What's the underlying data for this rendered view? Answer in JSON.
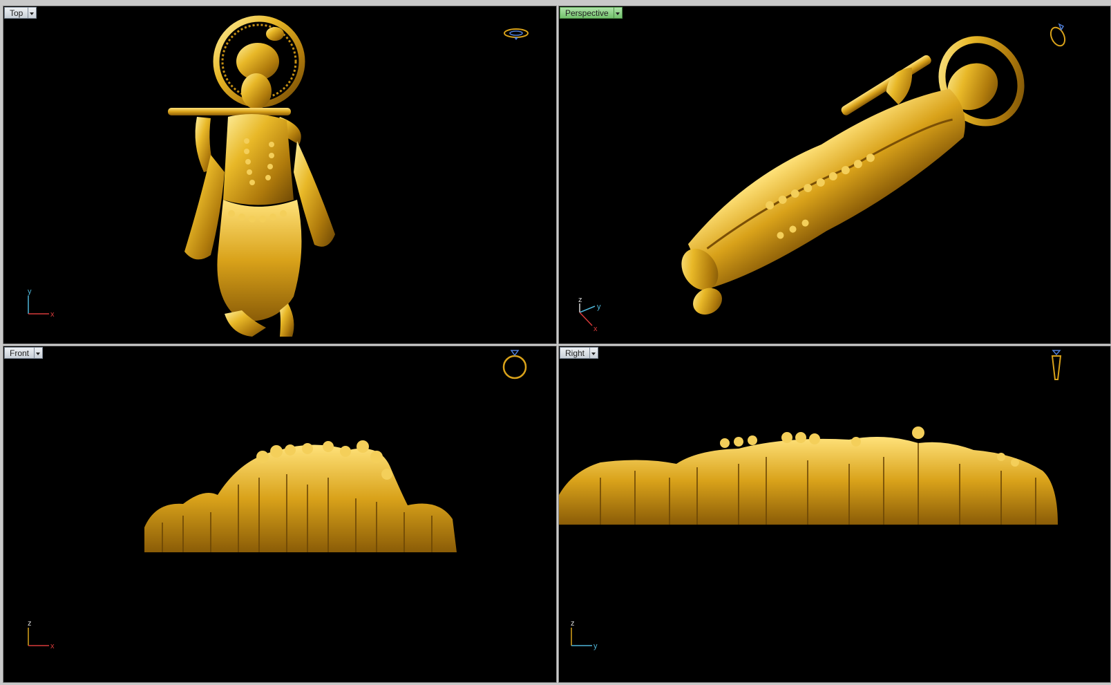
{
  "viewports": {
    "top": {
      "label": "Top",
      "axes": {
        "h": "x",
        "v": "y"
      }
    },
    "perspective": {
      "label": "Perspective",
      "axes": {
        "a": "z",
        "b": "y",
        "c": "x"
      }
    },
    "front": {
      "label": "Front",
      "axes": {
        "h": "x",
        "v": "z"
      }
    },
    "right": {
      "label": "Right",
      "axes": {
        "h": "y",
        "v": "z"
      }
    }
  },
  "colors": {
    "background": "#000000",
    "gold": "#d8a21a",
    "axis_x": "#d83a3a",
    "axis_y": "#4fb6d8",
    "axis_z": "#d8d8d8",
    "active_tab": "#72c06c"
  },
  "icons": {
    "top": "ring-top-icon",
    "perspective": "ring-perspective-icon",
    "front": "ring-front-icon",
    "right": "ring-side-icon"
  }
}
